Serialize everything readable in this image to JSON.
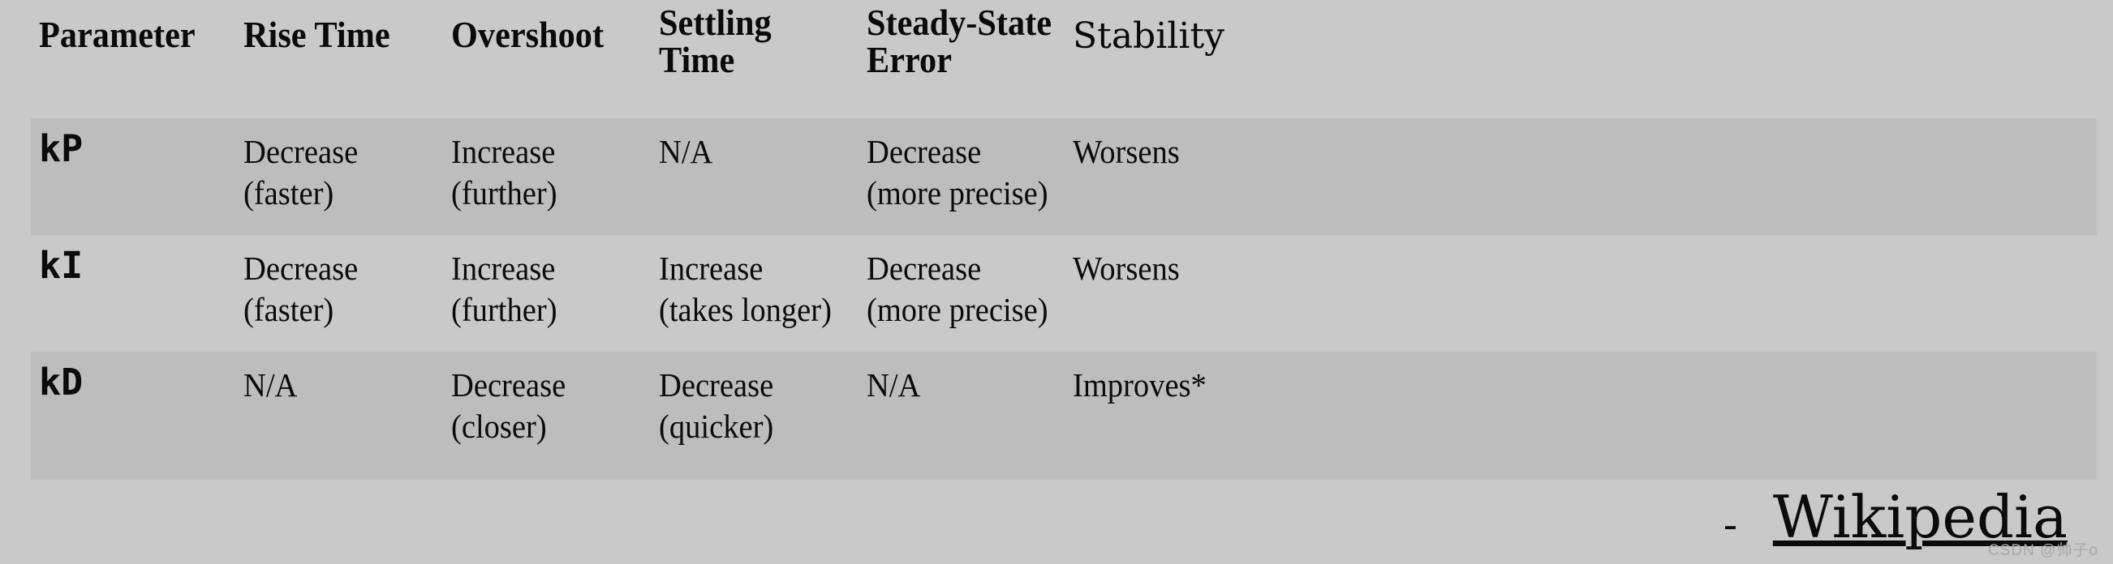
{
  "colors": {
    "page_background": "#c9c9c9",
    "row_band": "#bdbdbd",
    "text": "#0b0b0b",
    "watermark": "#a8a8a8"
  },
  "table": {
    "headers": [
      "Parameter",
      "Rise Time",
      "Overshoot",
      "Settling\nTime",
      "Steady-State\nError",
      "Stability"
    ],
    "rows": [
      {
        "parameter": "kP",
        "rise_time": "Decrease\n(faster)",
        "overshoot": "Increase\n(further)",
        "settling_time": "N/A",
        "steady_state_error": "Decrease\n(more precise)",
        "stability": "Worsens"
      },
      {
        "parameter": "kI",
        "rise_time": "Decrease\n(faster)",
        "overshoot": "Increase\n(further)",
        "settling_time": "Increase\n(takes longer)",
        "steady_state_error": "Decrease\n(more precise)",
        "stability": "Worsens"
      },
      {
        "parameter": "kD",
        "rise_time": "N/A",
        "overshoot": "Decrease\n(closer)",
        "settling_time": "Decrease\n(quicker)",
        "steady_state_error": "N/A",
        "stability": "Improves*"
      }
    ]
  },
  "footer": {
    "dash": "-",
    "source_label": "Wikipedia",
    "watermark": "CSDN @帅子o"
  }
}
